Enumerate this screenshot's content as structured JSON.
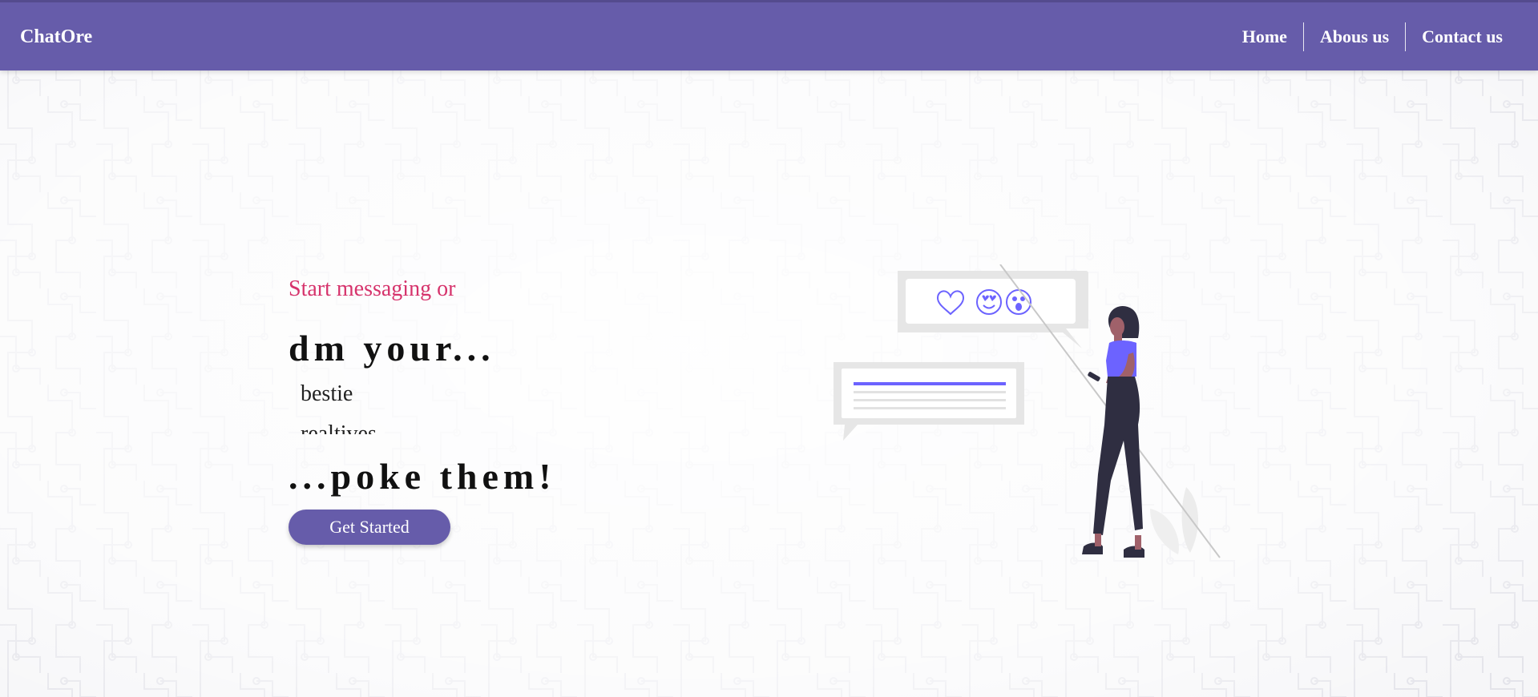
{
  "brand": {
    "name": "ChatOre"
  },
  "nav": {
    "items": [
      {
        "label": "Home"
      },
      {
        "label": "Abous us"
      },
      {
        "label": "Contact us"
      }
    ]
  },
  "hero": {
    "intro": "Start messaging or",
    "headline_1": "dm your...",
    "rotating_words": [
      "bestie",
      "realtives"
    ],
    "headline_2": "...poke them!",
    "cta_label": "Get Started"
  },
  "colors": {
    "navbar": "#665caa",
    "accent_text": "#d6336c",
    "button": "#665caa",
    "illustration_accent": "#6c63ff"
  },
  "icons": [
    "heart-icon",
    "heart-eyes-emoji-icon",
    "surprised-emoji-icon"
  ]
}
